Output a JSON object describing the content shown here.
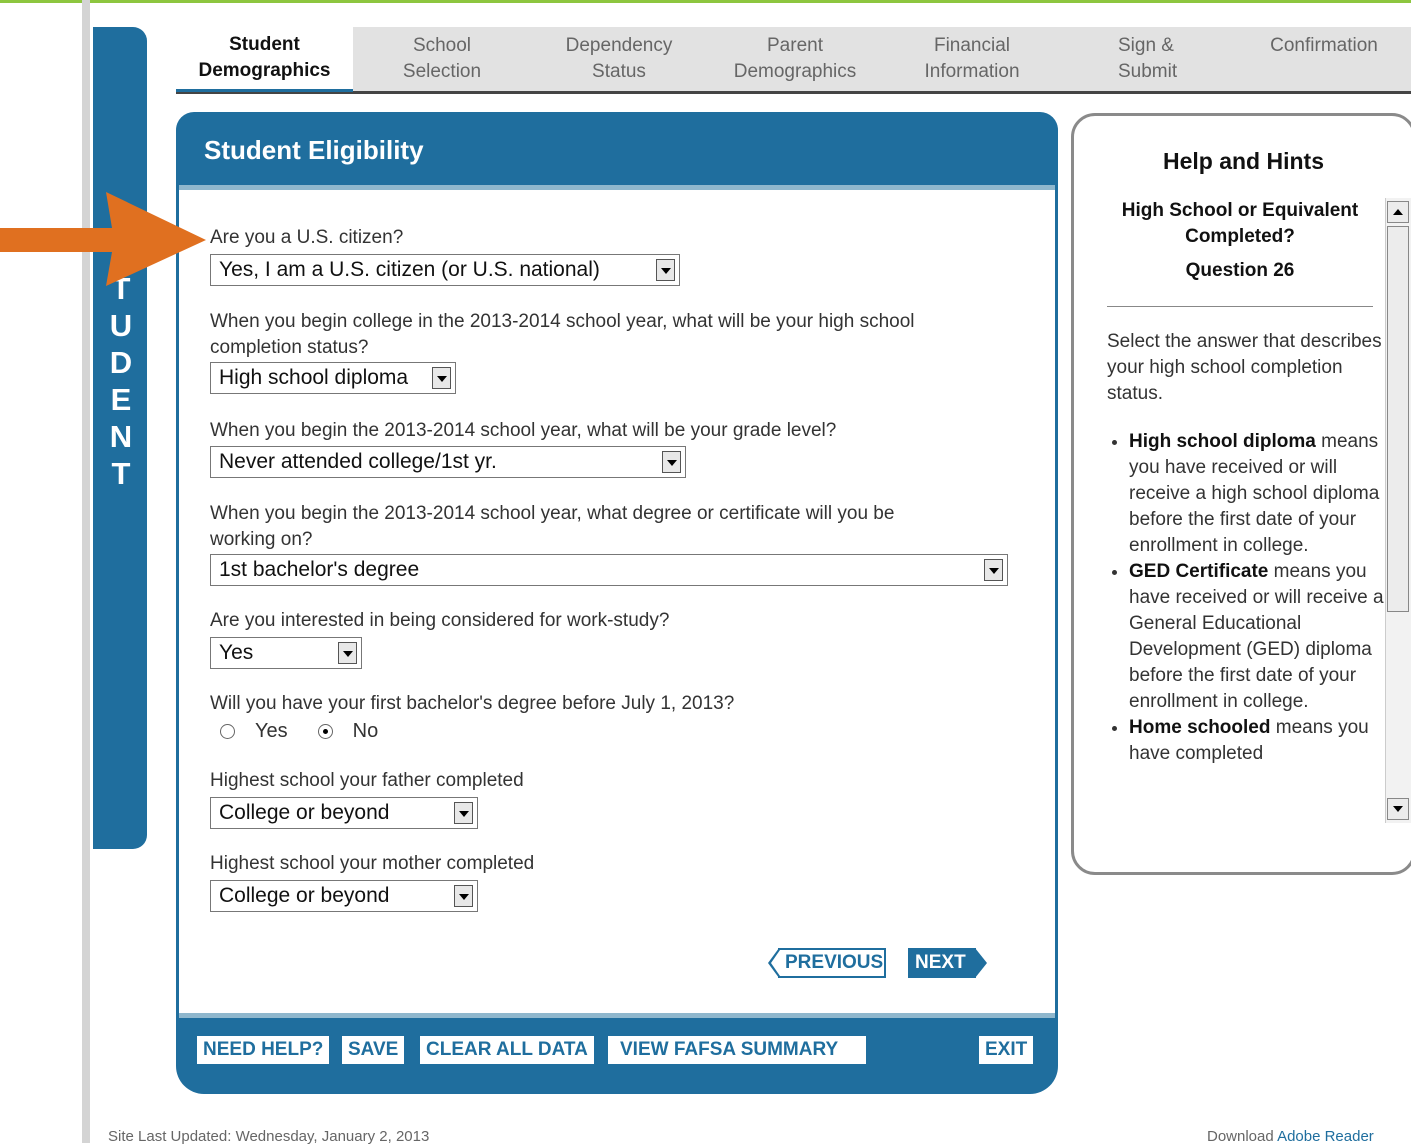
{
  "side_label": "STUDENT",
  "tabs": [
    {
      "line1": "Student",
      "line2": "Demographics"
    },
    {
      "line1": "School",
      "line2": "Selection"
    },
    {
      "line1": "Dependency",
      "line2": "Status"
    },
    {
      "line1": "Parent",
      "line2": "Demographics"
    },
    {
      "line1": "Financial",
      "line2": "Information"
    },
    {
      "line1": "Sign &",
      "line2": "Submit"
    },
    {
      "line1": "Confirmation",
      "line2": ""
    }
  ],
  "panel_title": "Student Eligibility",
  "questions": {
    "citizen": {
      "label": "Are you a U.S. citizen?",
      "value": "Yes, I am a U.S. citizen (or U.S. national)"
    },
    "hs_status": {
      "label_1": "When you begin college in the 2013-2014 school year, what will be your high school",
      "label_2": "completion status?",
      "value": "High school diploma"
    },
    "grade_level": {
      "label": "When you begin the 2013-2014 school year, what will be your grade level?",
      "value": "Never attended college/1st yr."
    },
    "degree": {
      "label_1": "When you begin the 2013-2014 school year, what degree or certificate will you be",
      "label_2": "working on?",
      "value": "1st bachelor's degree"
    },
    "work_study": {
      "label": "Are you interested in being considered for work-study?",
      "value": "Yes"
    },
    "bachelor_before": {
      "label": "Will you have your first bachelor's degree before July 1, 2013?",
      "yes": "Yes",
      "no": "No"
    },
    "father": {
      "label": "Highest school your father completed",
      "value": "College or beyond"
    },
    "mother": {
      "label": "Highest school your mother completed",
      "value": "College or beyond"
    }
  },
  "nav": {
    "previous": "PREVIOUS",
    "next": "NEXT"
  },
  "footer_buttons": {
    "need_help": "NEED HELP?",
    "save": "SAVE",
    "clear": "CLEAR ALL DATA",
    "summary": "VIEW FAFSA SUMMARY",
    "exit": "EXIT"
  },
  "help": {
    "title": "Help and Hints",
    "heading_1": "High School or Equivalent",
    "heading_2": "Completed?",
    "question": "Question 26",
    "intro": "Select the answer that describes your high school completion status.",
    "items": [
      {
        "term": "High school diploma",
        "text": "means you have received or will receive a high school diploma before the first date of your enrollment in college."
      },
      {
        "term": "GED Certificate",
        "text": "means you have received or will receive a General Educational Development (GED) diploma before the first date of your enrollment in college."
      },
      {
        "term": "Home schooled",
        "text": "means you have completed"
      }
    ]
  },
  "footer": {
    "updated": "Site Last Updated: Wednesday, January 2, 2013",
    "download": "Download",
    "reader": "Adobe Reader"
  },
  "colors": {
    "accent": "#1f6e9e",
    "arrow": "#e07020",
    "top_line": "#8dc63f"
  }
}
